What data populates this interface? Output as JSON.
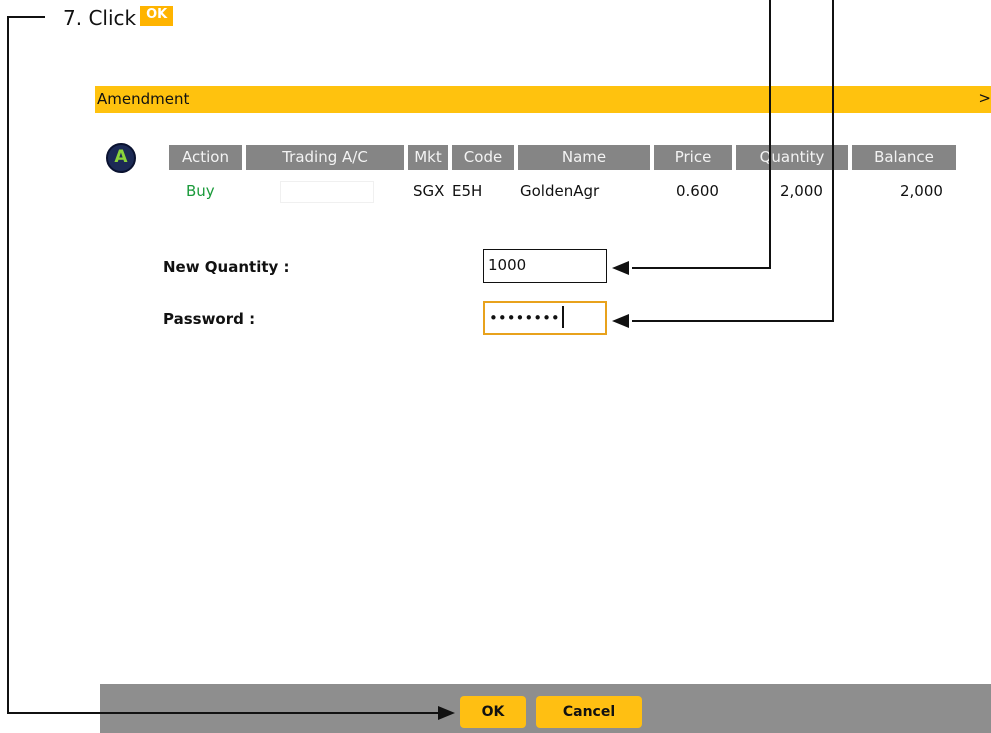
{
  "instruction": {
    "step_text": "7.  Click",
    "ok_label": "OK"
  },
  "dialog": {
    "title": "Amendment",
    "close_label": ">",
    "badge_letter": "A"
  },
  "order_table": {
    "headers": [
      "Action",
      "Trading A/C",
      "Mkt",
      "Code",
      "Name",
      "Price",
      "Quantity",
      "Balance"
    ],
    "row": {
      "action": "Buy",
      "trading_ac": "",
      "mkt": "SGX",
      "code": "E5H",
      "name": "GoldenAgr",
      "price": "0.600",
      "quantity": "2,000",
      "balance": "2,000"
    }
  },
  "form": {
    "new_quantity_label": "New Quantity :",
    "new_quantity_value": "1000",
    "password_label": "Password :",
    "password_value": "••••••••"
  },
  "footer": {
    "ok_label": "OK",
    "cancel_label": "Cancel"
  },
  "colors": {
    "titlebar": "#ffc20e",
    "header_cell": "#858585",
    "buy_text": "#1a9a3a",
    "button": "#ffbf12",
    "footer": "#8e8e8e",
    "focus_border": "#e8a21c"
  }
}
